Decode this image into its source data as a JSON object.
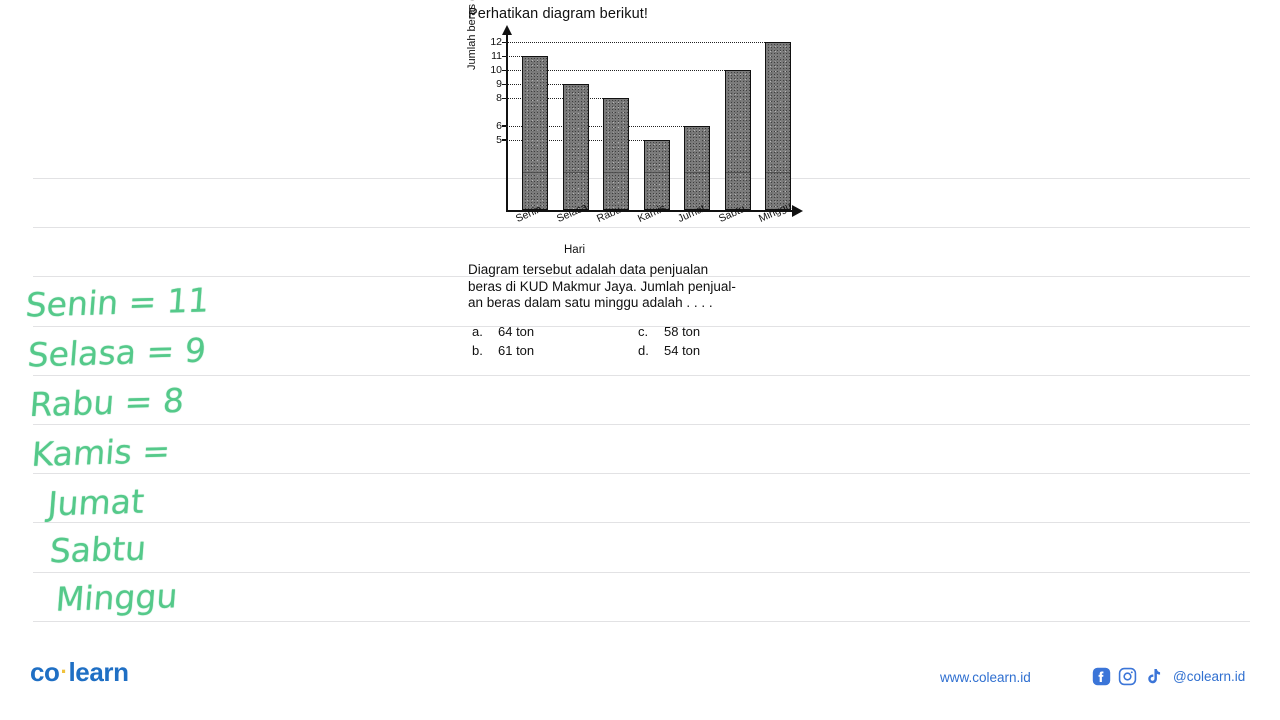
{
  "prompt": {
    "title": "Perhatikan diagram berikut!"
  },
  "question": {
    "line1": "Diagram tersebut adalah data penjualan",
    "line2": "beras di KUD Makmur Jaya. Jumlah penjual-",
    "line3": "an beras dalam satu minggu adalah . . . ."
  },
  "options": [
    {
      "key": "a.",
      "text": "64 ton"
    },
    {
      "key": "b.",
      "text": "61 ton"
    },
    {
      "key": "c.",
      "text": "58 ton"
    },
    {
      "key": "d.",
      "text": "54 ton"
    }
  ],
  "handwriting": {
    "lines": [
      "Senin = 11",
      "Selasa = 9",
      "Rabu = 8",
      "Kamis =",
      "Jumat",
      "Sabtu",
      "Minggu"
    ],
    "ink_color": "#55c98a"
  },
  "footer": {
    "logo_left": "co",
    "logo_dot": "·",
    "logo_right": "learn",
    "url": "www.colearn.id",
    "handle": "@colearn.id",
    "brand_color": "#2f6fd0",
    "social": [
      "facebook-icon",
      "instagram-icon",
      "tiktok-icon"
    ]
  },
  "chart_data": {
    "type": "bar",
    "title": "",
    "xlabel": "Hari",
    "ylabel": "Jumlah beras (ton)",
    "categories": [
      "Senin",
      "Selasa",
      "Rabu",
      "Kamis",
      "Jumat",
      "Sabtu",
      "Minggu"
    ],
    "values": [
      11,
      9,
      8,
      5,
      6,
      10,
      12
    ],
    "ytick_labels": [
      12,
      11,
      10,
      9,
      8,
      6,
      5
    ],
    "ylim": [
      0,
      12.6
    ],
    "grid": "horizontal-dotted-to-bar",
    "legend": "none",
    "bar_fill": "#7c7c7c",
    "bar_stroke": "#111111",
    "total": 61
  }
}
